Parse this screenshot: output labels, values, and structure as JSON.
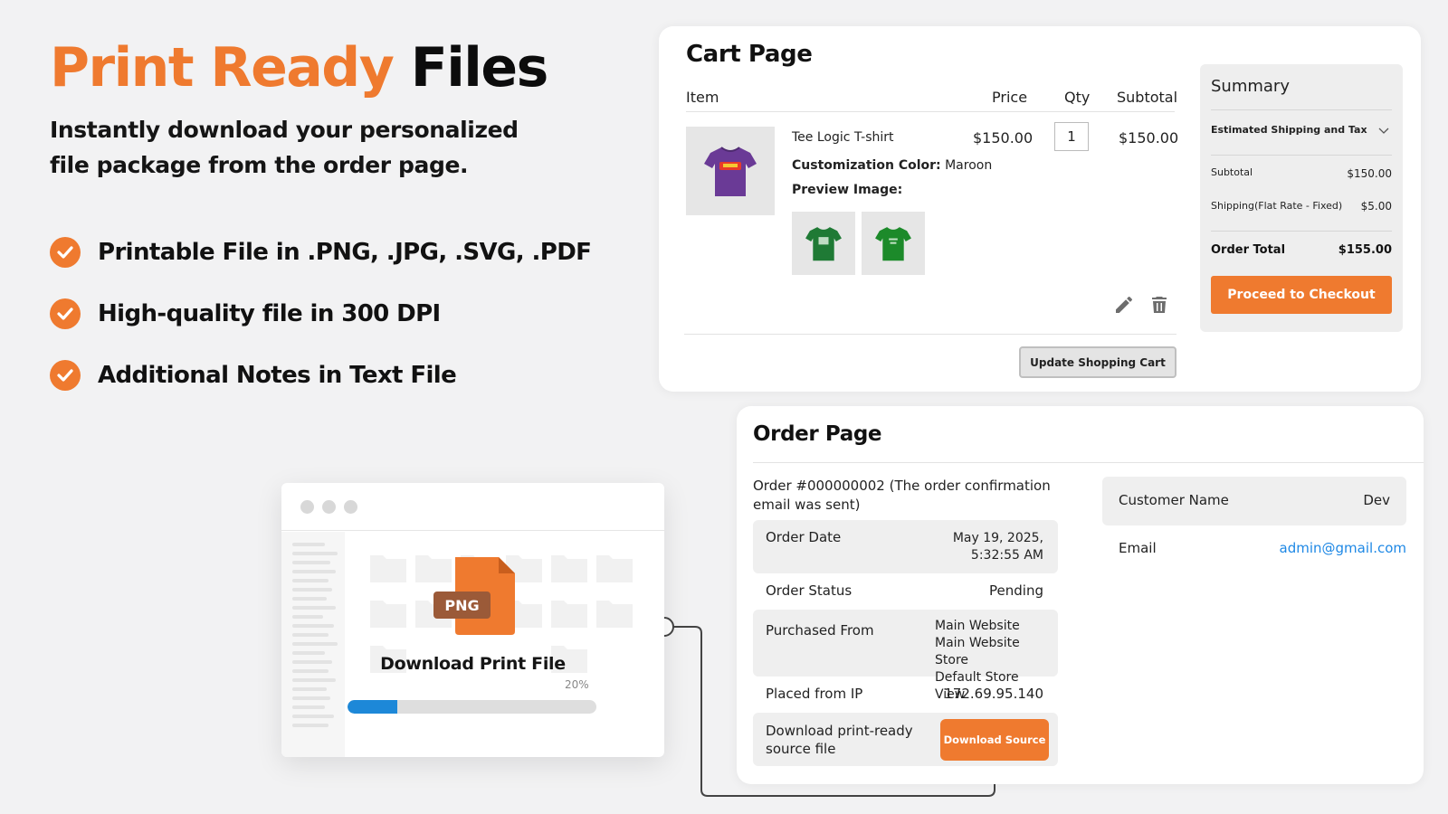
{
  "hero": {
    "title_accent": "Print Ready",
    "title_rest": "Files",
    "subtitle": "Instantly download your personalized file package from the order page.",
    "features": [
      {
        "icon": "check-circle-icon",
        "text": "Printable File in .PNG, .JPG, .SVG, .PDF"
      },
      {
        "icon": "check-circle-icon",
        "text": "High-quality file in 300 DPI"
      },
      {
        "icon": "check-circle-icon",
        "text": "Additional Notes in Text File"
      }
    ]
  },
  "cart": {
    "title": "Cart Page",
    "columns": {
      "item": "Item",
      "price": "Price",
      "qty": "Qty",
      "subtotal": "Subtotal"
    },
    "item": {
      "name": "Tee Logic T-shirt",
      "customization_label": "Customization Color:",
      "customization_value": "Maroon",
      "preview_label": "Preview Image:",
      "price": "$150.00",
      "qty": "1",
      "subtotal": "$150.00"
    },
    "update_button": "Update Shopping Cart",
    "summary": {
      "title": "Summary",
      "shipping_estimate": "Estimated Shipping and Tax",
      "subtotal_label": "Subtotal",
      "subtotal_value": "$150.00",
      "shipping_label": "Shipping(Flat Rate - Fixed)",
      "shipping_value": "$5.00",
      "total_label": "Order Total",
      "total_value": "$155.00",
      "checkout_button": "Proceed to Checkout"
    }
  },
  "order": {
    "title": "Order Page",
    "order_number": "Order #000000002 (The order confirmation email was sent)",
    "rows": {
      "date_label": "Order Date",
      "date_value": "May 19, 2025, 5:32:55 AM",
      "status_label": "Order Status",
      "status_value": "Pending",
      "purchased_label": "Purchased From",
      "purchased_line1": "Main Website",
      "purchased_line2": "Main Website Store",
      "purchased_line3": "Default Store View",
      "ip_label": "Placed from IP",
      "ip_value": "172.69.95.140",
      "download_label": "Download print-ready source file",
      "download_button": "Download Source"
    },
    "customer": {
      "name_label": "Customer Name",
      "name_value": "Dev",
      "email_label": "Email",
      "email_value": "admin@gmail.com"
    }
  },
  "download_window": {
    "file_badge": "PNG",
    "label": "Download Print File",
    "progress_text": "20%",
    "progress": 0.2
  },
  "colors": {
    "accent": "#ef7a2f",
    "link": "#1e88e5",
    "progress": "#1d88d8",
    "shirt_purple": "#6a3a96",
    "shirt_green": "#1f7a35"
  }
}
